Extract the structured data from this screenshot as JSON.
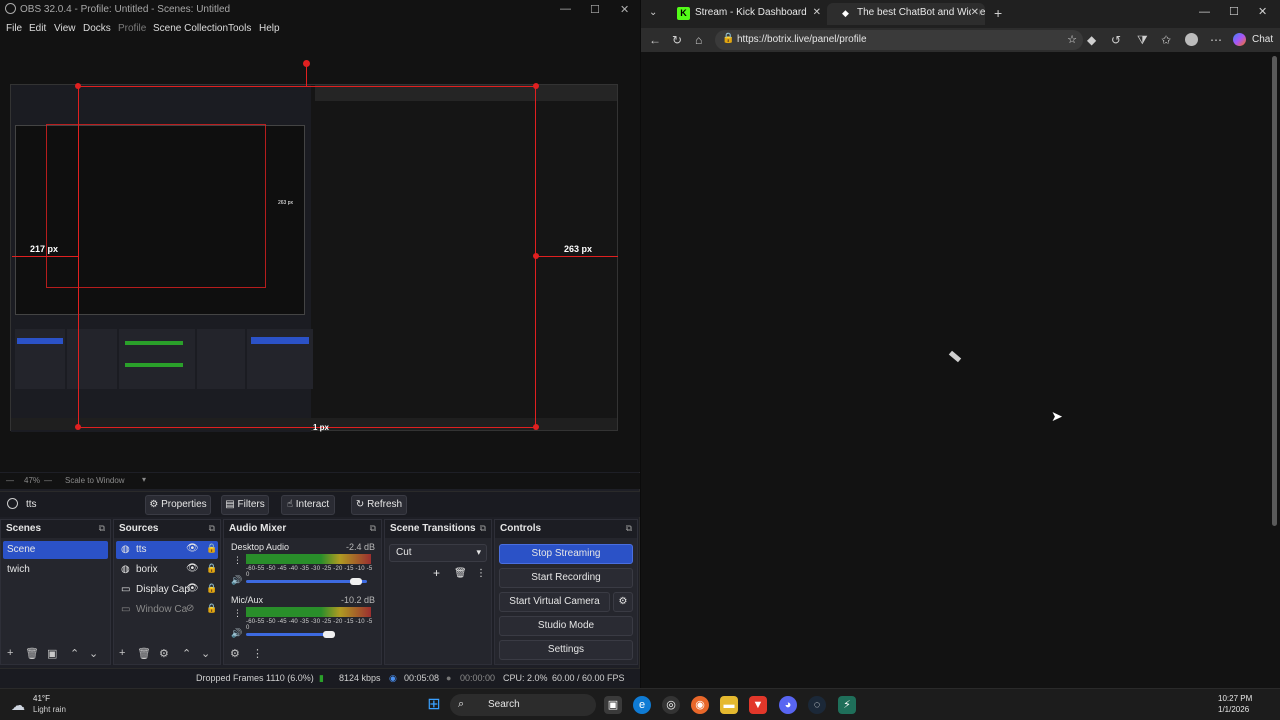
{
  "obs": {
    "title": "OBS 32.0.4 - Profile: Untitled - Scenes: Untitled",
    "menu": [
      "File",
      "Edit",
      "View",
      "Docks",
      "Profile",
      "Scene Collection",
      "Tools",
      "Help"
    ],
    "preview": {
      "measure_left": "217 px",
      "measure_right": "263 px",
      "measure_bottom": "1 px",
      "measure_inner": "263 px"
    },
    "zoom": {
      "percent": "47%",
      "scale_mode": "Scale to Window"
    },
    "source_bar": {
      "selected_source": "tts",
      "properties": "Properties",
      "filters": "Filters",
      "interact": "Interact",
      "refresh": "Refresh"
    },
    "scenes": {
      "title": "Scenes",
      "items": [
        "Scene",
        "twich"
      ]
    },
    "sources": {
      "title": "Sources",
      "items": [
        "tts",
        "borix",
        "Display Cap",
        "Window Ca"
      ]
    },
    "audio_mixer": {
      "title": "Audio Mixer",
      "scale": "-60-55 -50 -45 -40 -35 -30 -25 -20 -15 -10 -5  0",
      "channels": [
        {
          "name": "Desktop Audio",
          "db": "-2.4 dB"
        },
        {
          "name": "Mic/Aux",
          "db": "-10.2 dB"
        }
      ]
    },
    "transitions": {
      "title": "Scene Transitions",
      "selected": "Cut"
    },
    "controls": {
      "title": "Controls",
      "stop_streaming": "Stop Streaming",
      "start_recording": "Start Recording",
      "start_virtual_camera": "Start Virtual Camera",
      "studio_mode": "Studio Mode",
      "settings": "Settings"
    },
    "status": {
      "dropped": "Dropped Frames 1110 (6.0%)",
      "kbps": "8124 kbps",
      "stream_time": "00:05:08",
      "rec_time": "00:00:00",
      "cpu": "CPU: 2.0%",
      "fps": "60.00 / 60.00 FPS"
    }
  },
  "browser": {
    "tabs": [
      {
        "title": "Stream - Kick Dashboard",
        "icon": "kick-icon"
      },
      {
        "title": "The best ChatBot and Widgets for",
        "icon": "botrix-icon"
      }
    ],
    "url": "https://botrix.live/panel/profile",
    "chat_label": "Chat"
  },
  "taskbar": {
    "weather_temp": "41°F",
    "weather_desc": "Light rain",
    "search": "Search",
    "time": "10:27 PM",
    "date": "1/1/2026"
  },
  "colors": {
    "accent": "#2b52c7",
    "red_guide": "#e02020",
    "kick_green": "#53fc18"
  }
}
